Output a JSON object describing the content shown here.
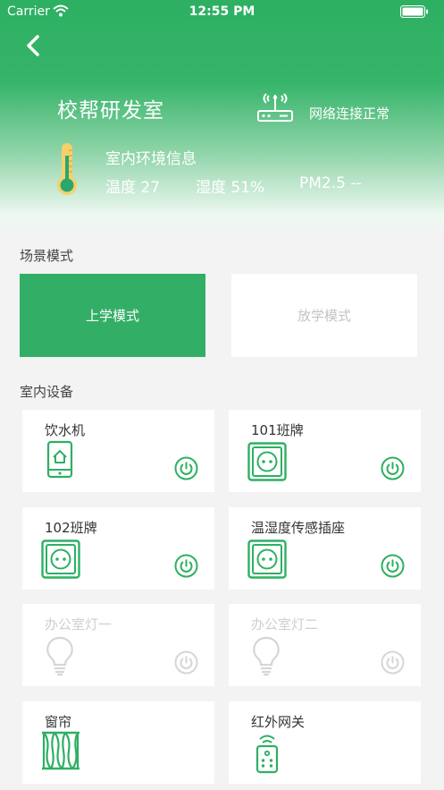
{
  "status_bar": {
    "carrier": "Carrier",
    "time": "12:55 PM"
  },
  "header": {
    "room_name": "校帮研发室",
    "network_status": "网络连接正常",
    "env_title": "室内环境信息",
    "temperature": "温度 27",
    "humidity": "湿度 51%",
    "pm25": "PM2.5 --"
  },
  "scenes": {
    "title": "场景模式",
    "items": [
      {
        "label": "上学模式",
        "active": true
      },
      {
        "label": "放学模式",
        "active": false
      }
    ]
  },
  "devices": {
    "title": "室内设备",
    "items": [
      {
        "name": "饮水机",
        "icon": "phone-home-icon",
        "on": true
      },
      {
        "name": "101班牌",
        "icon": "socket-icon",
        "on": true
      },
      {
        "name": "102班牌",
        "icon": "socket-icon",
        "on": true
      },
      {
        "name": "温湿度传感插座",
        "icon": "socket-icon",
        "on": true
      },
      {
        "name": "办公室灯一",
        "icon": "bulb-icon",
        "on": false
      },
      {
        "name": "办公室灯二",
        "icon": "bulb-icon",
        "on": false
      },
      {
        "name": "窗帘",
        "icon": "curtain-icon",
        "on": true
      },
      {
        "name": "红外网关",
        "icon": "remote-icon",
        "on": true
      }
    ]
  },
  "colors": {
    "accent": "#2db062",
    "disabled": "#cfcfcf"
  }
}
